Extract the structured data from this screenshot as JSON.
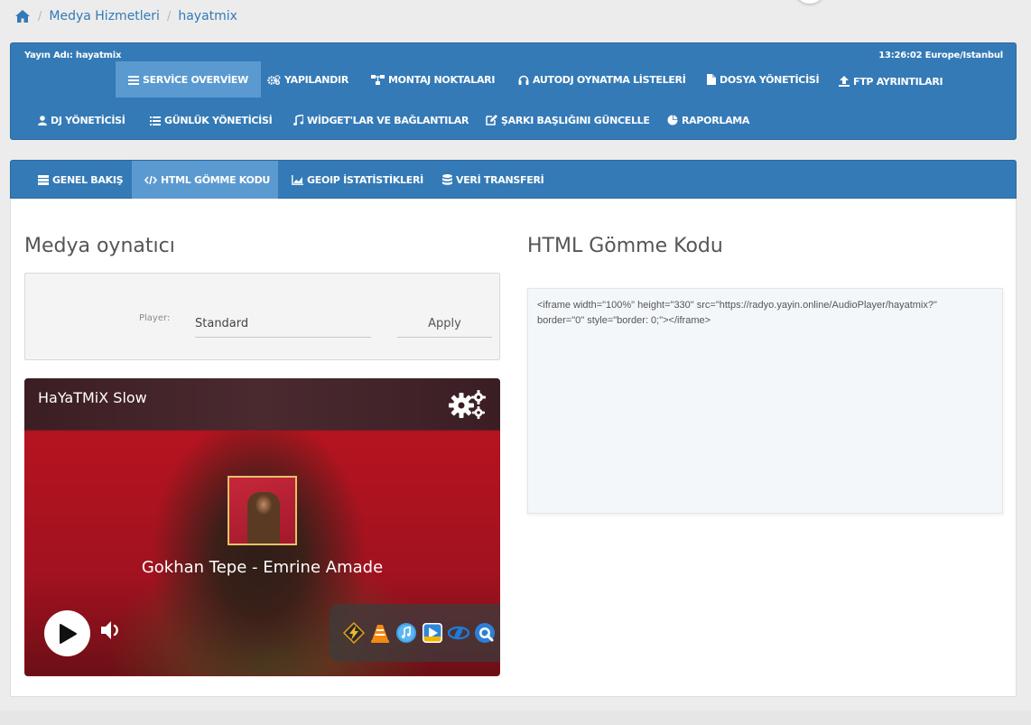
{
  "breadcrumb": {
    "items": [
      "Medya Hizmetleri",
      "hayatmix"
    ],
    "separator": "/"
  },
  "nav": {
    "stream_label": "Yayın Adı: hayatmix",
    "time": "13:26:02 Europe/Istanbul",
    "items": [
      {
        "label": "SERVİCE OVERVİEW",
        "icon": "list-icon",
        "active": true
      },
      {
        "label": "YAPILANDIR",
        "icon": "cogs-icon"
      },
      {
        "label": "MONTAJ NOKTALARI",
        "icon": "sitemap-icon"
      },
      {
        "label": "AUTODJ OYNATMA LİSTELERİ",
        "icon": "headphones-icon"
      },
      {
        "label": "DOSYA YÖNETİCİSİ",
        "icon": "file-icon"
      },
      {
        "label": "FTP AYRINTILARI",
        "icon": "upload-icon"
      },
      {
        "label": "DJ YÖNETİCİSİ",
        "icon": "user-icon"
      },
      {
        "label": "GÜNLÜK YÖNETİCİSİ",
        "icon": "list-icon"
      },
      {
        "label": "WİDGET'LAR VE BAĞLANTILAR",
        "icon": "music-icon"
      },
      {
        "label": "ŞARKI BAŞLIĞINI GÜNCELLE",
        "icon": "edit-icon"
      },
      {
        "label": "RAPORLAMA",
        "icon": "pie-chart-icon"
      }
    ]
  },
  "subnav": {
    "items": [
      {
        "label": "GENEL BAKIŞ",
        "icon": "server-icon"
      },
      {
        "label": "HTML GÖMME KODU",
        "icon": "code-icon",
        "active": true
      },
      {
        "label": "GEOIP İSTATİSTİKLERİ",
        "icon": "area-chart-icon"
      },
      {
        "label": "VERİ TRANSFERİ",
        "icon": "database-icon"
      }
    ]
  },
  "player_section": {
    "title": "Medya oynatıcı",
    "player_label": "Player:",
    "player_value": "Standard",
    "apply_label": "Apply"
  },
  "media_player": {
    "station": "HaYaTMiX Slow",
    "track": "Gokhan Tepe - Emrine Amade",
    "apps": [
      "winamp-icon",
      "vlc-icon",
      "itunes-icon",
      "media-player-icon",
      "realplayer-icon",
      "quicktime-icon"
    ]
  },
  "embed_section": {
    "title": "HTML Gömme Kodu",
    "code_line1": "<iframe width=\"100%\" height=\"330\" src=\"https://radyo.yayin.online/AudioPlayer/hayatmix?\"",
    "code_line2": "border=\"0\" style=\"border: 0;\"></iframe>"
  },
  "colors": {
    "primary": "#337ab7",
    "active_tab": "#5b99d1",
    "link": "#337ab7"
  }
}
